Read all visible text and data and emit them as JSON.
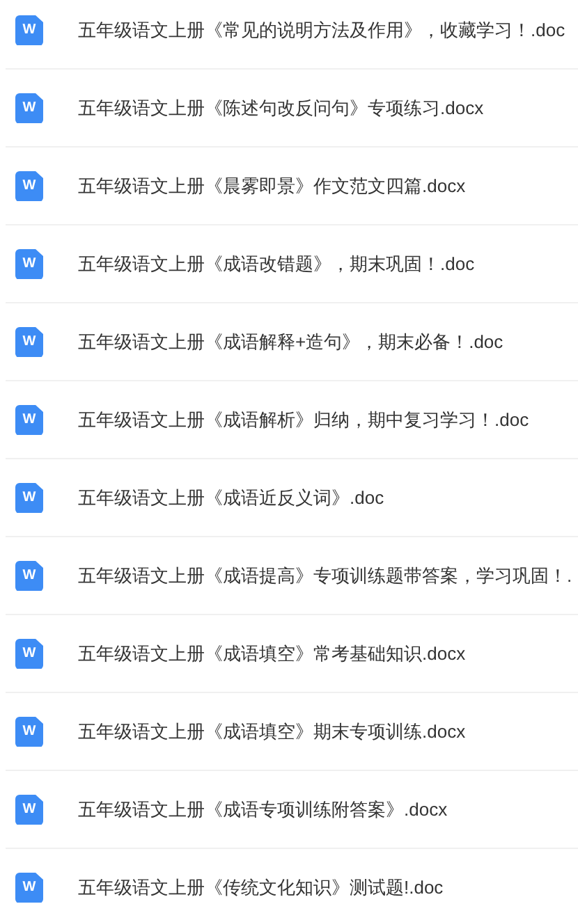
{
  "files": [
    {
      "icon_text": "W",
      "name": "五年级语文上册《常见的说明方法及作用》，收藏学习！.doc"
    },
    {
      "icon_text": "W",
      "name": "五年级语文上册《陈述句改反问句》专项练习.docx"
    },
    {
      "icon_text": "W",
      "name": "五年级语文上册《晨雾即景》作文范文四篇.docx"
    },
    {
      "icon_text": "W",
      "name": "五年级语文上册《成语改错题》，期末巩固！.doc"
    },
    {
      "icon_text": "W",
      "name": "五年级语文上册《成语解释+造句》，期末必备！.doc"
    },
    {
      "icon_text": "W",
      "name": "五年级语文上册《成语解析》归纳，期中复习学习！.doc"
    },
    {
      "icon_text": "W",
      "name": "五年级语文上册《成语近反义词》.doc"
    },
    {
      "icon_text": "W",
      "name": "五年级语文上册《成语提高》专项训练题带答案，学习巩固！."
    },
    {
      "icon_text": "W",
      "name": "五年级语文上册《成语填空》常考基础知识.docx"
    },
    {
      "icon_text": "W",
      "name": "五年级语文上册《成语填空》期末专项训练.docx"
    },
    {
      "icon_text": "W",
      "name": "五年级语文上册《成语专项训练附答案》.docx"
    },
    {
      "icon_text": "W",
      "name": "五年级语文上册《传统文化知识》测试题!.doc"
    }
  ]
}
